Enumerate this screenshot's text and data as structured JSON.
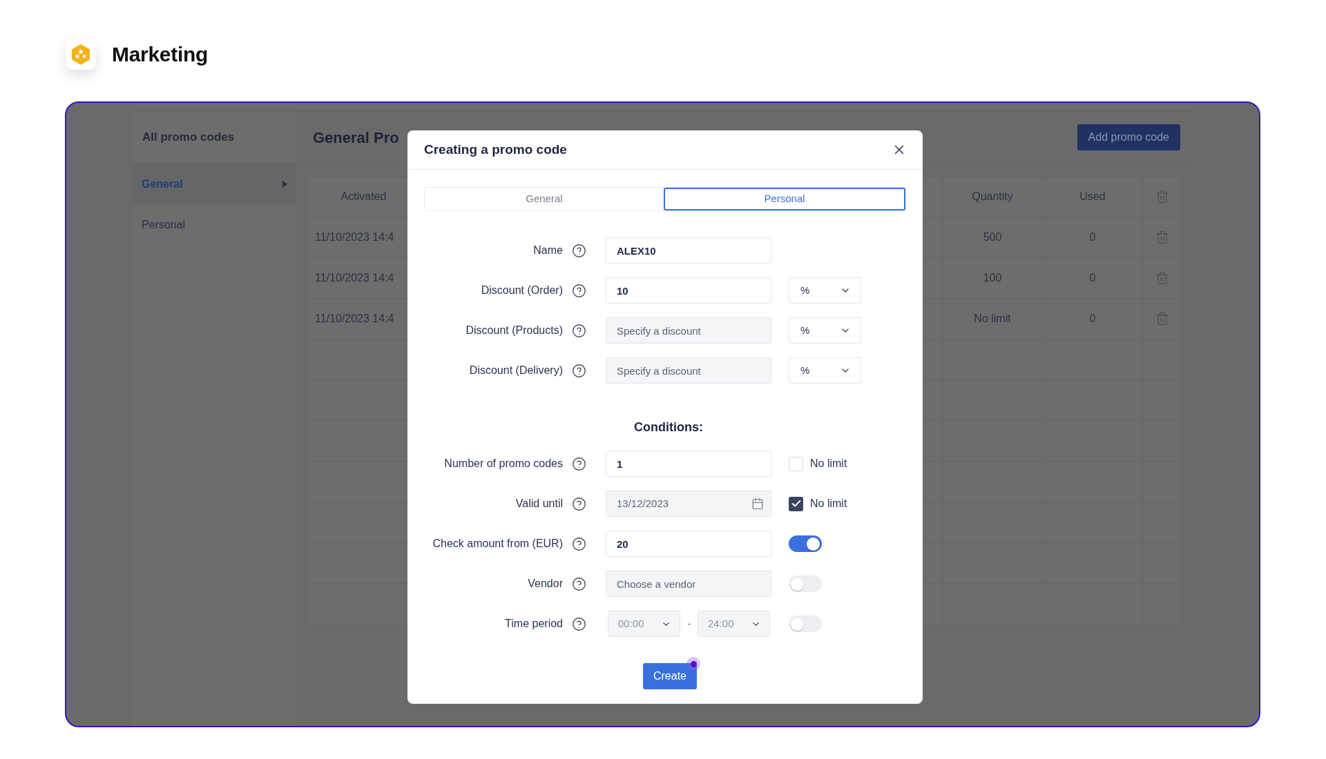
{
  "header": {
    "title": "Marketing"
  },
  "sidebar": {
    "title": "All promo codes",
    "items": [
      {
        "label": "General",
        "selected": true
      },
      {
        "label": "Personal",
        "selected": false
      }
    ]
  },
  "main": {
    "title": "General Pro",
    "add_button": "Add promo code"
  },
  "table": {
    "columns": [
      "Activated",
      "Quantity",
      "Used"
    ],
    "rows": [
      {
        "activated": "11/10/2023 14:4",
        "quantity": "500",
        "used": "0"
      },
      {
        "activated": "11/10/2023 14:4",
        "quantity": "100",
        "used": "0"
      },
      {
        "activated": "11/10/2023 14:4",
        "quantity": "No limit",
        "used": "0"
      }
    ]
  },
  "modal": {
    "title": "Creating a promo code",
    "tabs": [
      {
        "label": "General",
        "selected": false
      },
      {
        "label": "Personal",
        "selected": true
      }
    ],
    "fields": [
      {
        "kind": "text",
        "label": "Name",
        "value": "ALEX10",
        "disabled": false
      },
      {
        "kind": "text",
        "label": "Discount (Order)",
        "value": "10",
        "disabled": false,
        "extra": {
          "kind": "select",
          "value": "%"
        }
      },
      {
        "kind": "text",
        "label": "Discount (Products)",
        "placeholder": "Specify a discount",
        "disabled": true,
        "extra": {
          "kind": "select",
          "value": "%"
        }
      },
      {
        "kind": "text",
        "label": "Discount (Delivery)",
        "placeholder": "Specify a discount",
        "disabled": true,
        "extra": {
          "kind": "select",
          "value": "%"
        }
      }
    ],
    "conditions_title": "Conditions:",
    "conditions": [
      {
        "kind": "text",
        "label": "Number of promo codes",
        "value": "1",
        "disabled": false,
        "extra": {
          "kind": "checkbox",
          "label": "No limit",
          "checked": false
        }
      },
      {
        "kind": "date",
        "label": "Valid until",
        "value": "13/12/2023",
        "disabled": true,
        "extra": {
          "kind": "checkbox",
          "label": "No limit",
          "checked": true
        }
      },
      {
        "kind": "text",
        "label": "Check amount from (EUR)",
        "value": "20",
        "disabled": false,
        "extra": {
          "kind": "toggle",
          "on": true
        }
      },
      {
        "kind": "text",
        "label": "Vendor",
        "placeholder": "Choose a vendor",
        "disabled": true,
        "extra": {
          "kind": "toggle",
          "on": false
        }
      },
      {
        "kind": "time_range",
        "label": "Time period",
        "from": "00:00",
        "separator": "-",
        "to": "24:00",
        "disabled": true,
        "extra": {
          "kind": "toggle",
          "on": false
        }
      }
    ],
    "submit": "Create"
  }
}
